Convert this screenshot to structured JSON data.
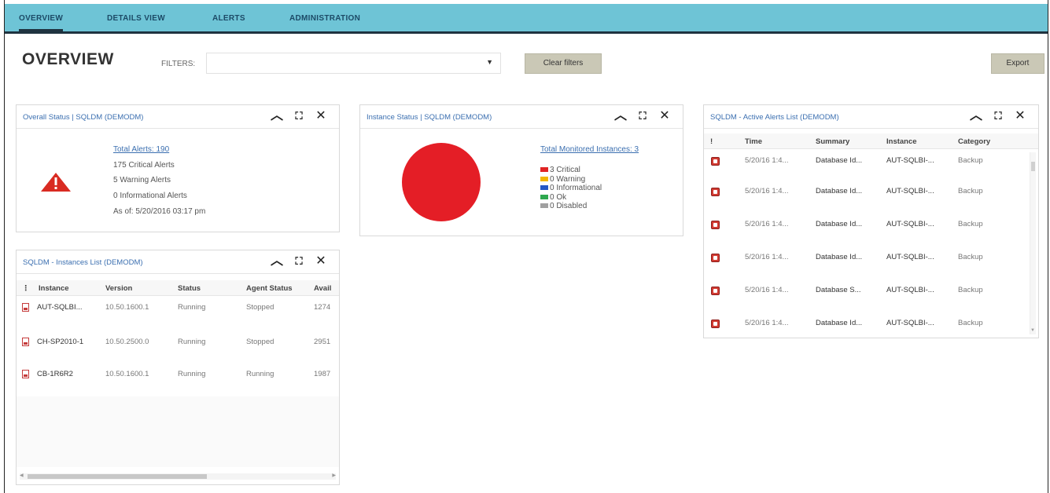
{
  "nav": {
    "tabs": [
      {
        "label": "OVERVIEW",
        "active": true
      },
      {
        "label": "DETAILS VIEW",
        "active": false
      },
      {
        "label": "ALERTS",
        "active": false
      },
      {
        "label": "ADMINISTRATION",
        "active": false
      }
    ]
  },
  "header": {
    "title": "OVERVIEW",
    "filters_label": "FILTERS:",
    "filter_value": "",
    "clear_filters": "Clear filters",
    "export": "Export"
  },
  "overall_status": {
    "title": "Overall Status | SQLDM (DEMODM)",
    "total_alerts": "Total Alerts: 190",
    "critical": "175 Critical Alerts",
    "warning": "5 Warning Alerts",
    "informational": "0 Informational Alerts",
    "as_of": "As of: 5/20/2016 03:17 pm"
  },
  "instance_status": {
    "title": "Instance Status | SQLDM (DEMODM)",
    "total": "Total Monitored Instances: 3",
    "legend": [
      {
        "label": "3 Critical",
        "color": "#e02424"
      },
      {
        "label": "0 Warning",
        "color": "#f2b600"
      },
      {
        "label": "0 Informational",
        "color": "#2457c5"
      },
      {
        "label": "0 Ok",
        "color": "#2ea84f"
      },
      {
        "label": "0 Disabled",
        "color": "#a0a0a0"
      }
    ]
  },
  "instances_list": {
    "title": "SQLDM - Instances List (DEMODM)",
    "columns": [
      "Instance",
      "Version",
      "Status",
      "Agent Status",
      "Avail"
    ],
    "rows": [
      {
        "instance": "AUT-SQLBI...",
        "version": "10.50.1600.1",
        "status": "Running",
        "agent": "Stopped",
        "avail": "1274"
      },
      {
        "instance": "CH-SP2010-1",
        "version": "10.50.2500.0",
        "status": "Running",
        "agent": "Stopped",
        "avail": "2951"
      },
      {
        "instance": "CB-1R6R2",
        "version": "10.50.1600.1",
        "status": "Running",
        "agent": "Running",
        "avail": "1987"
      }
    ]
  },
  "active_alerts": {
    "title": "SQLDM - Active Alerts List (DEMODM)",
    "columns": [
      "!",
      "Time",
      "Summary",
      "Instance",
      "Category"
    ],
    "rows": [
      {
        "time": "5/20/16 1:4...",
        "summary": "Database Id...",
        "instance": "AUT-SQLBI-...",
        "category": "Backup"
      },
      {
        "time": "5/20/16 1:4...",
        "summary": "Database Id...",
        "instance": "AUT-SQLBI-...",
        "category": "Backup"
      },
      {
        "time": "5/20/16 1:4...",
        "summary": "Database Id...",
        "instance": "AUT-SQLBI-...",
        "category": "Backup"
      },
      {
        "time": "5/20/16 1:4...",
        "summary": "Database Id...",
        "instance": "AUT-SQLBI-...",
        "category": "Backup"
      },
      {
        "time": "5/20/16 1:4...",
        "summary": "Database S...",
        "instance": "AUT-SQLBI-...",
        "category": "Backup"
      },
      {
        "time": "5/20/16 1:4...",
        "summary": "Database Id...",
        "instance": "AUT-SQLBI-...",
        "category": "Backup"
      }
    ]
  },
  "icons": {
    "collapse": "chevron-up-icon",
    "maximize": "expand-icon",
    "close": "close-icon",
    "warning": "warning-triangle-icon",
    "instance": "instance-document-icon",
    "alert": "alert-square-icon"
  }
}
